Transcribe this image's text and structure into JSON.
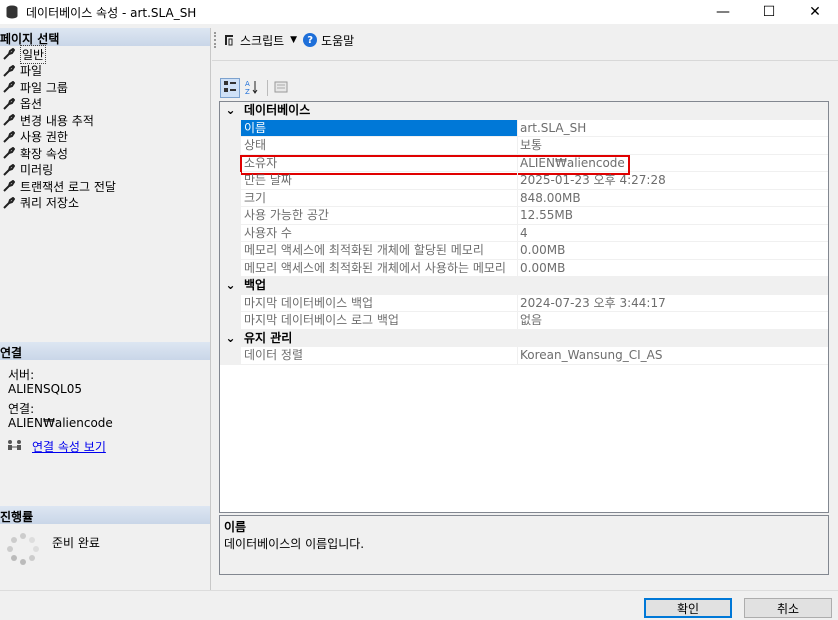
{
  "window": {
    "title": "데이터베이스 속성 - art.SLA_SH",
    "controls": {
      "minimize": "—",
      "maximize": "☐",
      "close": "✕"
    }
  },
  "left": {
    "select_page_header": "페이지 선택",
    "pages": [
      {
        "label": "일반"
      },
      {
        "label": "파일"
      },
      {
        "label": "파일 그룹"
      },
      {
        "label": "옵션"
      },
      {
        "label": "변경 내용 추적"
      },
      {
        "label": "사용 권한"
      },
      {
        "label": "확장 속성"
      },
      {
        "label": "미러링"
      },
      {
        "label": "트랜잭션 로그 전달"
      },
      {
        "label": "쿼리 저장소"
      }
    ],
    "connection_header": "연결",
    "server_label": "서버:",
    "server_value": "ALIENSQL05",
    "connection_label": "연결:",
    "connection_value": "ALIEN₩aliencode",
    "view_connection_link": "연결 속성 보기",
    "progress_header": "진행률",
    "progress_status": "준비 완료"
  },
  "toolbar": {
    "script_label": "스크립트",
    "help_label": "도움말"
  },
  "grid": {
    "categories": [
      {
        "label": "데이터베이스",
        "rows": [
          {
            "name": "이름",
            "value": "art.SLA_SH"
          },
          {
            "name": "상태",
            "value": "보통"
          },
          {
            "name": "소유자",
            "value": "ALIEN₩aliencode"
          },
          {
            "name": "만든 날짜",
            "value": "2025-01-23 오후 4:27:28"
          },
          {
            "name": "크기",
            "value": "848.00MB"
          },
          {
            "name": "사용 가능한 공간",
            "value": "12.55MB"
          },
          {
            "name": "사용자 수",
            "value": "4"
          },
          {
            "name": "메모리 액세스에 최적화된 개체에 할당된 메모리",
            "value": "0.00MB"
          },
          {
            "name": "메모리 액세스에 최적화된 개체에서 사용하는 메모리",
            "value": "0.00MB"
          }
        ]
      },
      {
        "label": "백업",
        "rows": [
          {
            "name": "마지막 데이터베이스 백업",
            "value": "2024-07-23 오후 3:44:17"
          },
          {
            "name": "마지막 데이터베이스 로그 백업",
            "value": "없음"
          }
        ]
      },
      {
        "label": "유지 관리",
        "rows": [
          {
            "name": "데이터 정렬",
            "value": "Korean_Wansung_CI_AS"
          }
        ]
      }
    ]
  },
  "description": {
    "title": "이름",
    "text": "데이터베이스의 이름입니다."
  },
  "buttons": {
    "ok": "확인",
    "cancel": "취소"
  },
  "colors": {
    "selection": "#0078d7",
    "highlight": "#e00000",
    "link": "#0000ee"
  }
}
